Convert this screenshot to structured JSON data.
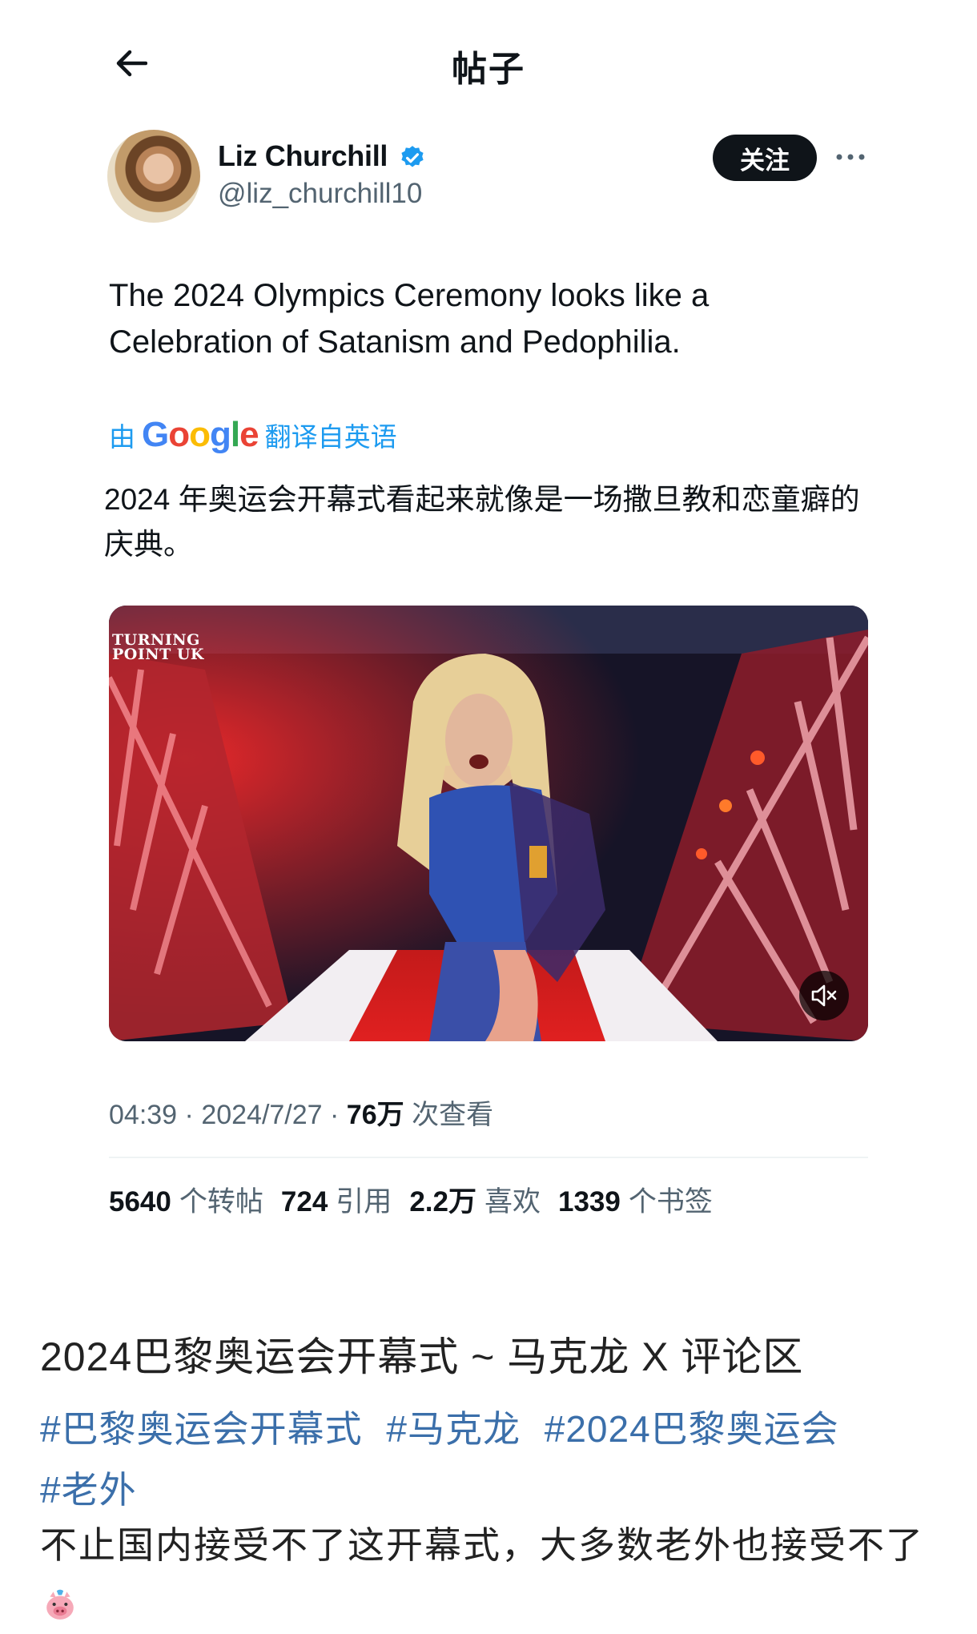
{
  "header": {
    "title": "帖子"
  },
  "post": {
    "author": {
      "name": "Liz Churchill",
      "handle": "@liz_churchill10"
    },
    "follow_label": "关注",
    "text": "The 2024 Olympics Ceremony looks like a Celebration of Satanism and Pedophilia.",
    "translation": {
      "prefix": "由",
      "provider": "Google",
      "suffix": "翻译自英语",
      "text": "2024 年奥运会开幕式看起来就像是一场撒旦教和恋童癖的庆典。"
    },
    "media": {
      "watermark_line1": "TURNING",
      "watermark_line2": "POINT UK"
    },
    "meta": {
      "time": "04:39",
      "date": "2024/7/27",
      "views_value": "76万",
      "views_label": "次查看"
    },
    "stats": [
      {
        "value": "5640",
        "label": "个转帖"
      },
      {
        "value": "724",
        "label": "引用"
      },
      {
        "value": "2.2万",
        "label": "喜欢"
      },
      {
        "value": "1339",
        "label": "个书签"
      }
    ]
  },
  "article": {
    "title": "2024巴黎奥运会开幕式 ~ 马克龙 X 评论区",
    "tags": [
      "#巴黎奥运会开幕式",
      "#马克龙",
      "#2024巴黎奥运会",
      "#老外"
    ],
    "body": "不止国内接受不了这开幕式，大多数老外也接受不了"
  },
  "icons": {
    "back": "arrow-left-icon",
    "verified": "verified-badge-icon",
    "more": "more-dots-icon",
    "mute": "volume-mute-icon",
    "emoji": "pig-face-emoji"
  },
  "colors": {
    "link_blue": "#1d9bf0",
    "tag_blue": "#3b6faa",
    "muted_gray": "#536471",
    "text_dark": "#0f1419"
  }
}
